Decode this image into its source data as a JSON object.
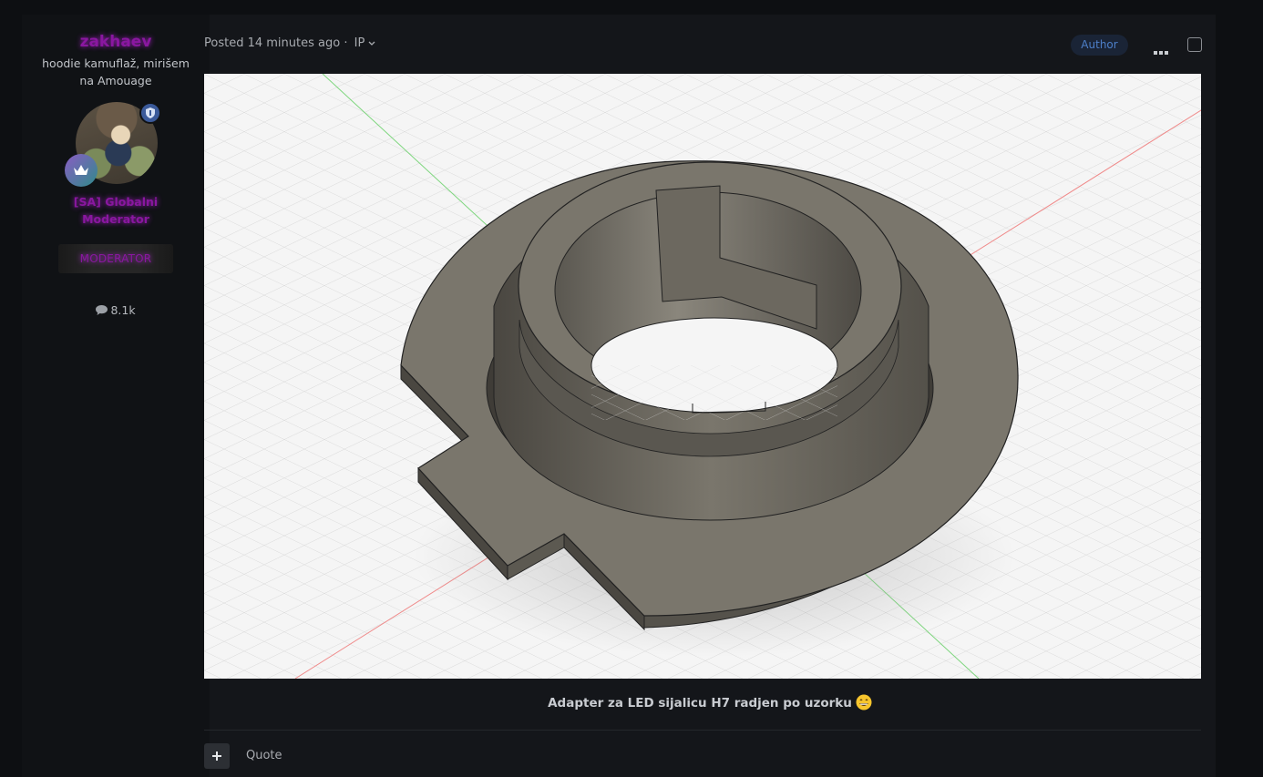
{
  "author": {
    "name": "zakhaev",
    "title": "hoodie kamuflaž, mirišem na Amouage",
    "group": "[SA] Globalni Moderator",
    "badge": "MODERATOR",
    "post_count": "8.1k"
  },
  "post": {
    "posted_label": "Posted",
    "time": "14 minutes ago",
    "separator": "·",
    "ip": "IP",
    "author_badge": "Author",
    "caption": "Adapter za LED sijalicu H7 radjen po uzorku",
    "caption_emoji": "grinning-face-icon",
    "quote_label": "Quote"
  },
  "colors": {
    "background": "#0d0f12",
    "panel": "#14161a",
    "username": "#8a17a0",
    "author_badge_text": "#4d7fc9",
    "model_gray": "#7a766c"
  }
}
